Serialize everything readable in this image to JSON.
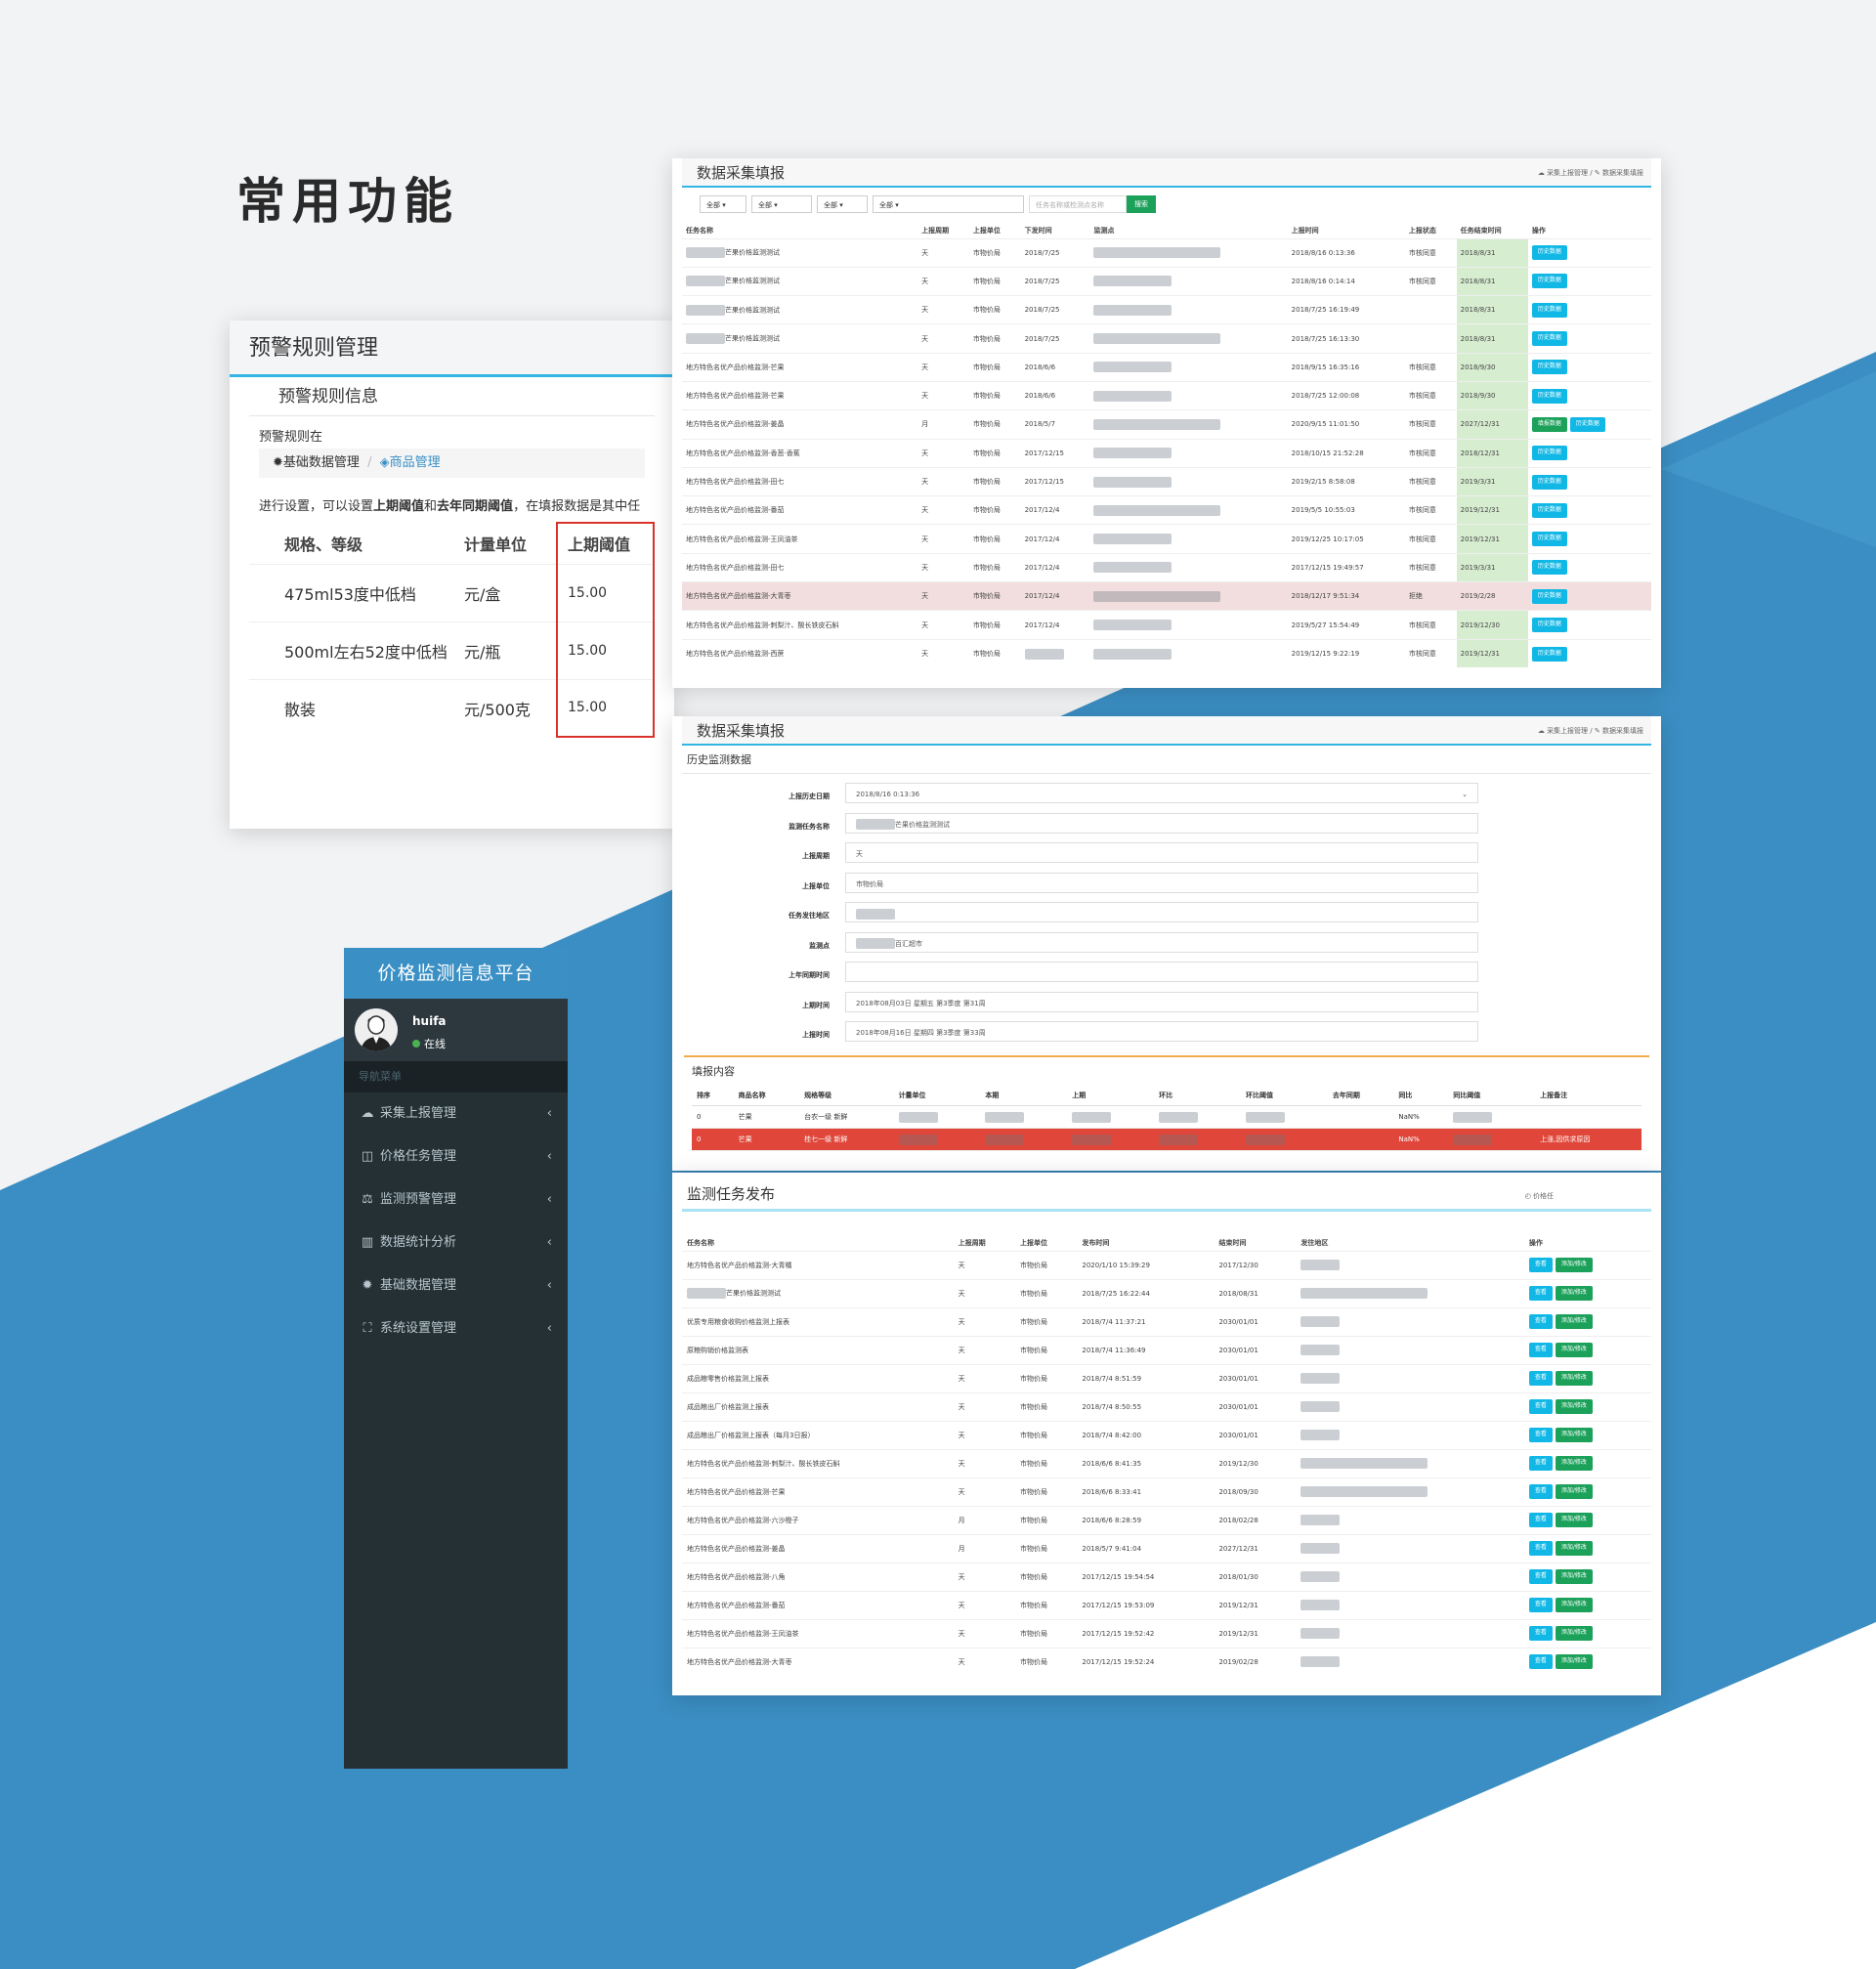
{
  "heading": "常用功能",
  "warning_rule": {
    "title": "预警规则管理",
    "subtitle": "预警规则信息",
    "text1": "预警规则在",
    "crumb1": "基础数据管理",
    "crumb_sep": "/",
    "crumb2": "商品管理",
    "text2a": "进行设置，可以设置",
    "text2b": "上期阈值",
    "text2c": "和",
    "text2d": "去年同期阈值",
    "text2e": "，在填报数据是其中任",
    "headers": [
      "规格、等级",
      "计量单位",
      "上期阈值"
    ],
    "rows": [
      [
        "475ml53度中低档",
        "元/盒",
        "15.00"
      ],
      [
        "500ml左右52度中低档",
        "元/瓶",
        "15.00"
      ],
      [
        "散装",
        "元/500克",
        "15.00"
      ]
    ]
  },
  "collect": {
    "title": "数据采集填报",
    "bc1": "采集上报管理",
    "bc_sep": "/",
    "bc2": "数据采集填报",
    "filters": [
      "全部",
      "全部",
      "全部",
      "全部"
    ],
    "search_placeholder": "任务名称或检测点名称",
    "search_btn": "搜索",
    "headers": [
      "任务名称",
      "上报周期",
      "上报单位",
      "下发时间",
      "监测点",
      "上报时间",
      "上报状态",
      "任务结束时间",
      "操作"
    ],
    "rows": [
      [
        "芒果价格监测测试",
        "天",
        "市物价局",
        "2018/7/25",
        "",
        "2018/8/16 0:13:36",
        "市核同意",
        "2018/8/31"
      ],
      [
        "芒果价格监测测试",
        "天",
        "市物价局",
        "2018/7/25",
        "",
        "2018/8/16 0:14:14",
        "市核同意",
        "2018/8/31"
      ],
      [
        "芒果价格监测测试",
        "天",
        "市物价局",
        "2018/7/25",
        "",
        "2018/7/25 16:19:49",
        "",
        "2018/8/31"
      ],
      [
        "芒果价格监测测试",
        "天",
        "市物价局",
        "2018/7/25",
        "",
        "2018/7/25 16:13:30",
        "",
        "2018/8/31"
      ],
      [
        "地方特色名优产品价格监测-芒果",
        "天",
        "市物价局",
        "2018/6/6",
        "",
        "2018/9/15 16:35:16",
        "市核同意",
        "2018/9/30"
      ],
      [
        "地方特色名优产品价格监测-芒果",
        "天",
        "市物价局",
        "2018/6/6",
        "",
        "2018/7/25 12:00:08",
        "市核同意",
        "2018/9/30"
      ],
      [
        "地方特色名优产品价格监测-姜晶",
        "月",
        "市物价局",
        "2018/5/7",
        "",
        "2020/9/15 11:01:50",
        "市核同意",
        "2027/12/31"
      ],
      [
        "地方特色名优产品价格监测-香葱·香蕉",
        "天",
        "市物价局",
        "2017/12/15",
        "",
        "2018/10/15 21:52:28",
        "市核同意",
        "2018/12/31"
      ],
      [
        "地方特色名优产品价格监测-田七",
        "天",
        "市物价局",
        "2017/12/15",
        "",
        "2019/2/15 8:58:08",
        "市核同意",
        "2019/3/31"
      ],
      [
        "地方特色名优产品价格监测-番茄",
        "天",
        "市物价局",
        "2017/12/4",
        "",
        "2019/5/5 10:55:03",
        "市核同意",
        "2019/12/31"
      ],
      [
        "地方特色名优产品价格监测-王凤油茶",
        "天",
        "市物价局",
        "2017/12/4",
        "",
        "2019/12/25 10:17:05",
        "市核同意",
        "2019/12/31"
      ],
      [
        "地方特色名优产品价格监测-田七",
        "天",
        "市物价局",
        "2017/12/4",
        "",
        "2017/12/15 19:49:57",
        "市核同意",
        "2019/3/31"
      ],
      [
        "地方特色名优产品价格监测-大青枣",
        "天",
        "市物价局",
        "2017/12/4",
        "",
        "2018/12/17 9:51:34",
        "拒绝",
        "2019/2/28"
      ],
      [
        "地方特色名优产品价格监测-刺梨汁、酸长铁皮石斛",
        "天",
        "市物价局",
        "2017/12/4",
        "",
        "2019/5/27 15:54:49",
        "市核同意",
        "2019/12/30"
      ],
      [
        "地方特色名优产品价格监测-西蔗",
        "天",
        "市物价局",
        "",
        "",
        "2019/12/15 9:22:19",
        "市核同意",
        "2019/12/31"
      ]
    ],
    "btn_history": "历史数据",
    "btn_fill": "填报数据"
  },
  "sidebar": {
    "title": "价格监测信息平台",
    "user": "huifa",
    "status": "在线",
    "nav_header": "导航菜单",
    "items": [
      {
        "icon": "☁",
        "label": "采集上报管理"
      },
      {
        "icon": "◫",
        "label": "价格任务管理"
      },
      {
        "icon": "⚖",
        "label": "监测预警管理"
      },
      {
        "icon": "▥",
        "label": "数据统计分析"
      },
      {
        "icon": "✹",
        "label": "基础数据管理"
      },
      {
        "icon": "⛶",
        "label": "系统设置管理"
      }
    ],
    "chevron": "‹"
  },
  "history": {
    "title": "数据采集填报",
    "bc1": "采集上报管理",
    "bc_sep": "/",
    "bc2": "数据采集填报",
    "section": "历史监测数据",
    "fields": [
      {
        "label": "上报历史日期",
        "value": "2018/8/16 0:13:36"
      },
      {
        "label": "监测任务名称",
        "value": "芒果价格监测测试"
      },
      {
        "label": "上报周期",
        "value": "天"
      },
      {
        "label": "上报单位",
        "value": "市物价局"
      },
      {
        "label": "任务发往地区",
        "value": ""
      },
      {
        "label": "监测点",
        "value": "百汇超市"
      },
      {
        "label": "上年同期时间",
        "value": ""
      },
      {
        "label": "上期时间",
        "value": "2018年08月03日 星期五 第3季度 第31周"
      },
      {
        "label": "上报时间",
        "value": "2018年08月16日 星期四 第3季度 第33周"
      }
    ],
    "section2": "填报内容",
    "headers": [
      "排序",
      "商品名称",
      "规格等级",
      "计量单位",
      "本期",
      "上期",
      "环比",
      "环比阈值",
      "去年同期",
      "同比",
      "同比阈值",
      "上报备注"
    ],
    "rows": [
      [
        "0",
        "芒果",
        "台农一级 新鲜",
        "",
        "",
        "",
        "",
        "",
        "",
        "NaN%",
        "",
        ""
      ],
      [
        "0",
        "芒果",
        "桂七一级 新鲜",
        "",
        "",
        "",
        "",
        "",
        "",
        "NaN%",
        "",
        "上涨,因供求原因"
      ]
    ]
  },
  "publish": {
    "title": "监测任务发布",
    "bc": "价格任",
    "headers": [
      "任务名称",
      "上报周期",
      "上报单位",
      "发布时间",
      "结束时间",
      "发往地区",
      "操作"
    ],
    "rows": [
      [
        "地方特色名优产品价格监测-大青橘",
        "天",
        "市物价局",
        "2020/1/10 15:39:29",
        "2017/12/30"
      ],
      [
        "芒果价格监测测试",
        "天",
        "市物价局",
        "2018/7/25 16:22:44",
        "2018/08/31"
      ],
      [
        "优质专用粮食收购价格监测上报表",
        "天",
        "市物价局",
        "2018/7/4 11:37:21",
        "2030/01/01"
      ],
      [
        "原粮购销价格监测表",
        "天",
        "市物价局",
        "2018/7/4 11:36:49",
        "2030/01/01"
      ],
      [
        "成品粮零售价格监测上报表",
        "天",
        "市物价局",
        "2018/7/4 8:51:59",
        "2030/01/01"
      ],
      [
        "成品粮出厂价格监测上报表",
        "天",
        "市物价局",
        "2018/7/4 8:50:55",
        "2030/01/01"
      ],
      [
        "成品粮出厂价格监测上报表（每月3日报）",
        "天",
        "市物价局",
        "2018/7/4 8:42:00",
        "2030/01/01"
      ],
      [
        "地方特色名优产品价格监测-刺梨汁、酸长铁皮石斛",
        "天",
        "市物价局",
        "2018/6/6 8:41:35",
        "2019/12/30"
      ],
      [
        "地方特色名优产品价格监测-芒果",
        "天",
        "市物价局",
        "2018/6/6 8:33:41",
        "2018/09/30"
      ],
      [
        "地方特色名优产品价格监测-六沙橙子",
        "月",
        "市物价局",
        "2018/6/6 8:28:59",
        "2018/02/28"
      ],
      [
        "地方特色名优产品价格监测-姜晶",
        "月",
        "市物价局",
        "2018/5/7 9:41:04",
        "2027/12/31"
      ],
      [
        "地方特色名优产品价格监测-八角",
        "天",
        "市物价局",
        "2017/12/15 19:54:54",
        "2018/01/30"
      ],
      [
        "地方特色名优产品价格监测-番茄",
        "天",
        "市物价局",
        "2017/12/15 19:53:09",
        "2019/12/31"
      ],
      [
        "地方特色名优产品价格监测-王凤油茶",
        "天",
        "市物价局",
        "2017/12/15 19:52:42",
        "2019/12/31"
      ],
      [
        "地方特色名优产品价格监测-大青枣",
        "天",
        "市物价局",
        "2017/12/15 19:52:24",
        "2019/02/28"
      ]
    ],
    "btn_view": "查看",
    "btn_edit": "添加/修改"
  },
  "colors": {
    "accent": "#33b5e5",
    "green": "#1ba15a",
    "cyan": "#11b8e6",
    "blue_bg": "#3b8ec3",
    "sidebar": "#253035",
    "red_row": "#e0473a"
  }
}
